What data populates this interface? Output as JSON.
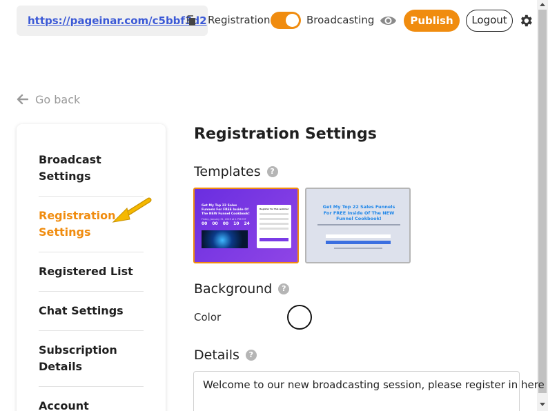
{
  "topbar": {
    "url": "https://pageinar.com/c5bbf3d2",
    "registration_label": "Registration",
    "broadcasting_label": "Broadcasting",
    "publish_label": "Publish",
    "logout_label": "Logout",
    "toggle_state": "broadcasting",
    "accent_color": "#f08c0f"
  },
  "nav": {
    "go_back": "Go back"
  },
  "sidebar": {
    "items": [
      {
        "line1": "Broadcast",
        "line2": "Settings"
      },
      {
        "line1": "Registration",
        "line2": "Settings",
        "active": true
      },
      {
        "line1": "Registered List"
      },
      {
        "line1": "Chat Settings"
      },
      {
        "line1": "Subscription",
        "line2": "Details"
      },
      {
        "line1": "Account"
      }
    ]
  },
  "main": {
    "title": "Registration Settings",
    "templates_heading": "Templates",
    "background_heading": "Background",
    "color_label": "Color",
    "color_value": "#ffffff",
    "details_heading": "Details",
    "details_text": "Welcome to our new broadcasting session, please register in here",
    "templates": [
      {
        "selected": true,
        "headline": "Get My Top 22 Sales Funnels For FREE Inside Of The NEW Funnel Cookbook!",
        "date": "Friday, January 31, 2025 at 1 PM EST",
        "countdown": [
          "00",
          "00",
          "00",
          "10",
          "24"
        ],
        "form_title": "Register for this webinar"
      },
      {
        "selected": false,
        "headline": "Get My Top 22 Sales Funnels For FREE Inside Of The NEW Funnel Cookbook!"
      }
    ]
  }
}
